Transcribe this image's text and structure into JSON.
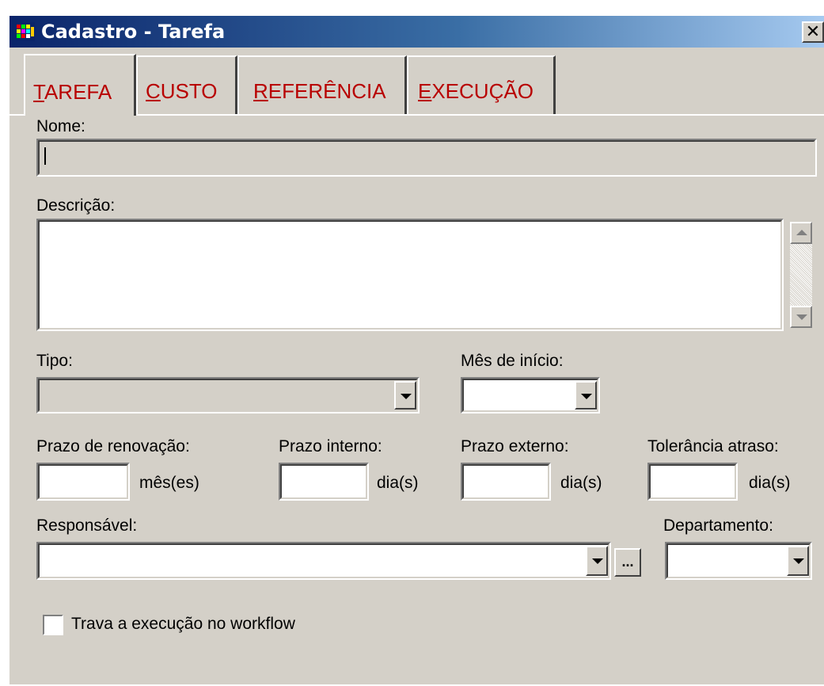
{
  "window": {
    "title": "Cadastro - Tarefa",
    "close_glyph": "✕",
    "icon": "app-grid-icon"
  },
  "tabs": [
    {
      "prefix": "",
      "underline": "T",
      "rest": "AREFA",
      "active": true
    },
    {
      "prefix": "",
      "underline": "C",
      "rest": "USTO",
      "active": false
    },
    {
      "prefix": "",
      "underline": "R",
      "rest": "EFERÊNCIA",
      "active": false
    },
    {
      "prefix": "",
      "underline": "E",
      "rest": "XECUÇÃO",
      "active": false
    }
  ],
  "form": {
    "nome_label": "Nome:",
    "nome_value": "",
    "descricao_label": "Descrição:",
    "descricao_value": "",
    "tipo_label": "Tipo:",
    "tipo_value": "",
    "mes_inicio_label": "Mês de início:",
    "mes_inicio_value": "",
    "prazo_renovacao_label": "Prazo de renovação:",
    "prazo_renovacao_unit": "mês(es)",
    "prazo_interno_label": "Prazo interno:",
    "prazo_interno_unit": "dia(s)",
    "prazo_externo_label": "Prazo externo:",
    "prazo_externo_unit": "dia(s)",
    "tolerancia_label": "Tolerância atraso:",
    "tolerancia_unit": "dia(s)",
    "responsavel_label": "Responsável:",
    "responsavel_value": "",
    "ellipsis_label": "...",
    "departamento_label": "Departamento:",
    "departamento_value": "",
    "trava_label": "Trava a execução no workflow",
    "trava_checked": false
  },
  "colors": {
    "titlebar_start": "#0a246a",
    "titlebar_end": "#a6caf0",
    "tab_text": "#b80000",
    "face": "#d4d0c8"
  }
}
